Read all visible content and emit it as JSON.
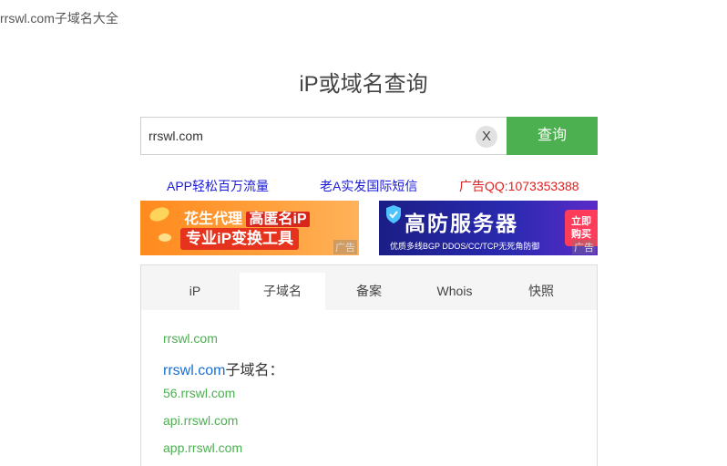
{
  "page": {
    "header_title": "rrswl.com子域名大全",
    "main_title": "iP或域名查询"
  },
  "search": {
    "value": "rrswl.com",
    "clear_label": "X",
    "submit_label": "查询"
  },
  "ad_links": [
    {
      "label": "APP轻松百万流量",
      "color": "#1a1ad8"
    },
    {
      "label": "老A实发国际短信",
      "color": "#1a1ad8"
    },
    {
      "label": "广告QQ:1073353388",
      "color": "#e02020"
    }
  ],
  "banners": {
    "left": {
      "brand": "花生代理",
      "highlight": "高匿名iP",
      "tagline": "专业iP变换工具",
      "ad_tag": "广告"
    },
    "right": {
      "title": "高防服务器",
      "subtitle": "优质多线BGP  DDOS/CC/TCP无死角防御",
      "buy_label_1": "立即",
      "buy_label_2": "购买",
      "ad_tag": "广告"
    }
  },
  "tabs": [
    {
      "label": "iP",
      "active": false
    },
    {
      "label": "子域名",
      "active": true
    },
    {
      "label": "备案",
      "active": false
    },
    {
      "label": "Whois",
      "active": false
    },
    {
      "label": "快照",
      "active": false
    }
  ],
  "results": {
    "domain": "rrswl.com",
    "heading_domain": "rrswl.com",
    "heading_suffix": "子域名：",
    "subdomains": [
      "56.rrswl.com",
      "api.rrswl.com",
      "app.rrswl.com"
    ]
  }
}
